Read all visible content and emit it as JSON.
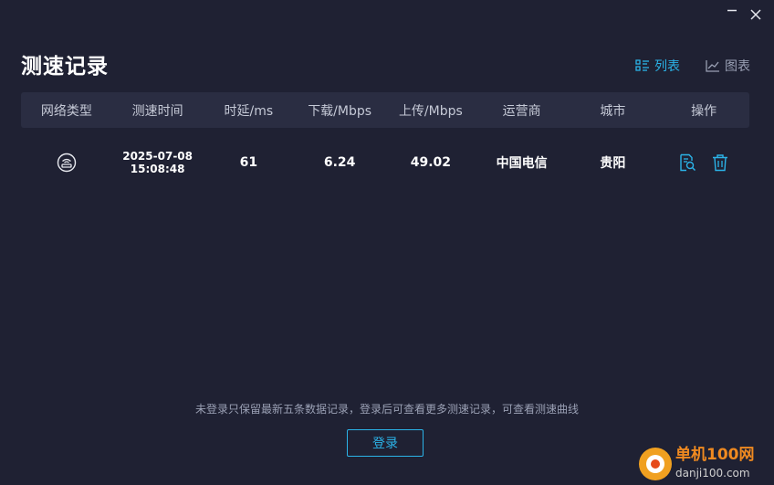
{
  "page": {
    "title": "测速记录"
  },
  "view_switch": {
    "list_label": "列表",
    "chart_label": "图表"
  },
  "table": {
    "headers": [
      "网络类型",
      "测速时间",
      "时延/ms",
      "下载/Mbps",
      "上传/Mbps",
      "运营商",
      "城市",
      "操作"
    ],
    "rows": [
      {
        "network_icon": "router-icon",
        "date": "2025-07-08",
        "time": "15:08:48",
        "latency": "61",
        "download": "6.24",
        "upload": "49.02",
        "isp": "中国电信",
        "city": "贵阳"
      }
    ]
  },
  "notice": "未登录只保留最新五条数据记录，登录后可查看更多测速记录，可查看测速曲线",
  "login_label": "登录",
  "watermark": {
    "name": "单机100网",
    "url": "danji100.com"
  },
  "colors": {
    "background": "#1f2133",
    "header_bg": "#2a2d42",
    "accent": "#2bb3e8"
  }
}
